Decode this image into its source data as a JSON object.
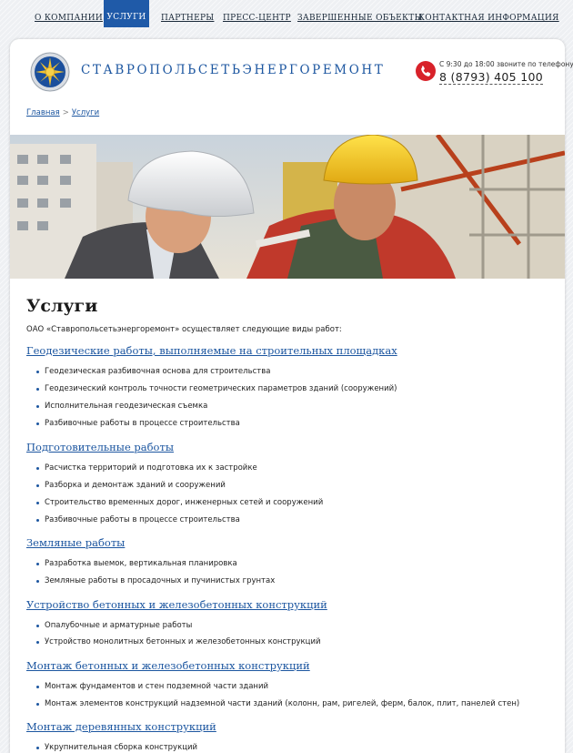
{
  "nav": {
    "items": [
      "О КОМПАНИИ",
      "УСЛУГИ",
      "ПАРТНЕРЫ",
      "ПРЕСС-ЦЕНТР",
      "ЗАВЕРШЕННЫЕ ОБЪЕКТЫ",
      "КОНТАКТНАЯ ИНФОРМАЦИЯ"
    ],
    "active": "УСЛУГИ"
  },
  "header": {
    "company_name": "СТАВРОПОЛЬСЕТЬЭНЕРГОРЕМОНТ",
    "phone_hours": "С 9:30 до 18:00 звоните по телефону",
    "phone_number": "8 (8793) 405 100"
  },
  "breadcrumb": {
    "home": "Главная",
    "separator": ">",
    "current": "Услуги"
  },
  "main": {
    "title": "Услуги",
    "intro": "ОАО «Ставропольсетьэнергоремонт» осуществляет следующие виды работ:",
    "sections": [
      {
        "title": "Геодезические работы, выполняемые на строительных площадках",
        "items": [
          "Геодезическая разбивочная основа для строительства",
          "Геодезический контроль точности геометрических параметров зданий (сооружений)",
          "Исполнительная геодезическая съемка",
          "Разбивочные работы в процессе строительства"
        ]
      },
      {
        "title": "Подготовительные работы",
        "items": [
          "Расчистка территорий и подготовка их к застройке",
          "Разборка и демонтаж зданий и сооружений",
          "Строительство временных дорог, инженерных сетей и сооружений",
          "Разбивочные работы в процессе строительства"
        ]
      },
      {
        "title": "Земляные работы",
        "items": [
          "Разработка выемок, вертикальная планировка",
          "Земляные работы в просадочных и пучинистых грунтах"
        ]
      },
      {
        "title": "Устройство бетонных и железобетонных конструкций",
        "items": [
          "Опалубочные и арматурные работы",
          "Устройство монолитных бетонных и железобетонных конструкций"
        ]
      },
      {
        "title": "Монтаж бетонных и железобетонных конструкций",
        "items": [
          "Монтаж фундаментов и стен подземной части зданий",
          "Монтаж элементов конструкций надземной части зданий (колонн, рам, ригелей, ферм, балок, плит, панелей стен)"
        ]
      },
      {
        "title": "Монтаж деревянных конструкций",
        "items": [
          "Укрупнительная сборка конструкций"
        ]
      }
    ]
  },
  "colors": {
    "accent": "#1f5aa8",
    "link": "#1c56a0",
    "phone": "#d8222a"
  },
  "icons": {
    "logo": "company-emblem-icon",
    "phone": "phone-icon"
  }
}
